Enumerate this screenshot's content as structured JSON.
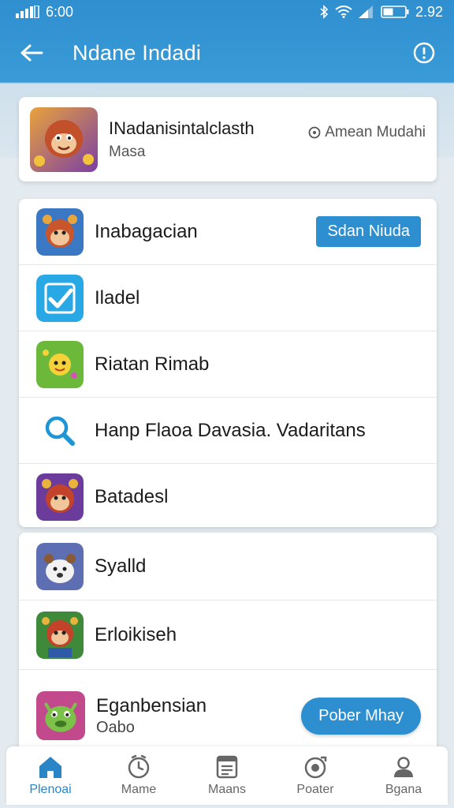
{
  "status_bar": {
    "left_text": "6:00",
    "right_text": "2.92"
  },
  "app_bar": {
    "title": "Ndane Indadi"
  },
  "featured": {
    "name": "INadanisintalclasth",
    "subtitle": "Masa",
    "side_text": "Amean Mudahi",
    "icon": "monkey-game-icon"
  },
  "list1": [
    {
      "label": "Inabagacian",
      "icon": "cartoon-face-icon",
      "button": "Sdan Niuda"
    },
    {
      "label": "Iladel",
      "icon": "checkmark-app-icon"
    },
    {
      "label": "Riatan Rimab",
      "icon": "sun-creature-icon"
    },
    {
      "label": "Hanp Flaoa Davasia. Vadaritans",
      "icon": "search-icon"
    },
    {
      "label": "Batadesl",
      "icon": "cartoon-face-icon"
    }
  ],
  "list2": [
    {
      "label": "Syalld",
      "icon": "polar-bear-icon"
    },
    {
      "label": "Erloikiseh",
      "icon": "cartoon-face-icon"
    },
    {
      "label": "Eganbensian",
      "sublabel": "Oabo",
      "icon": "green-monster-icon",
      "button": "Pober Mhay"
    }
  ],
  "bottom_nav": [
    {
      "label": "Plenoai",
      "icon": "home-icon",
      "active": true
    },
    {
      "label": "Mame",
      "icon": "clock-icon"
    },
    {
      "label": "Maans",
      "icon": "document-icon"
    },
    {
      "label": "Poater",
      "icon": "disc-icon"
    },
    {
      "label": "Bgana",
      "icon": "person-icon"
    }
  ],
  "colors": {
    "accent": "#2d8fcf",
    "header": "#3399d6",
    "active_nav": "#2a85c6"
  }
}
